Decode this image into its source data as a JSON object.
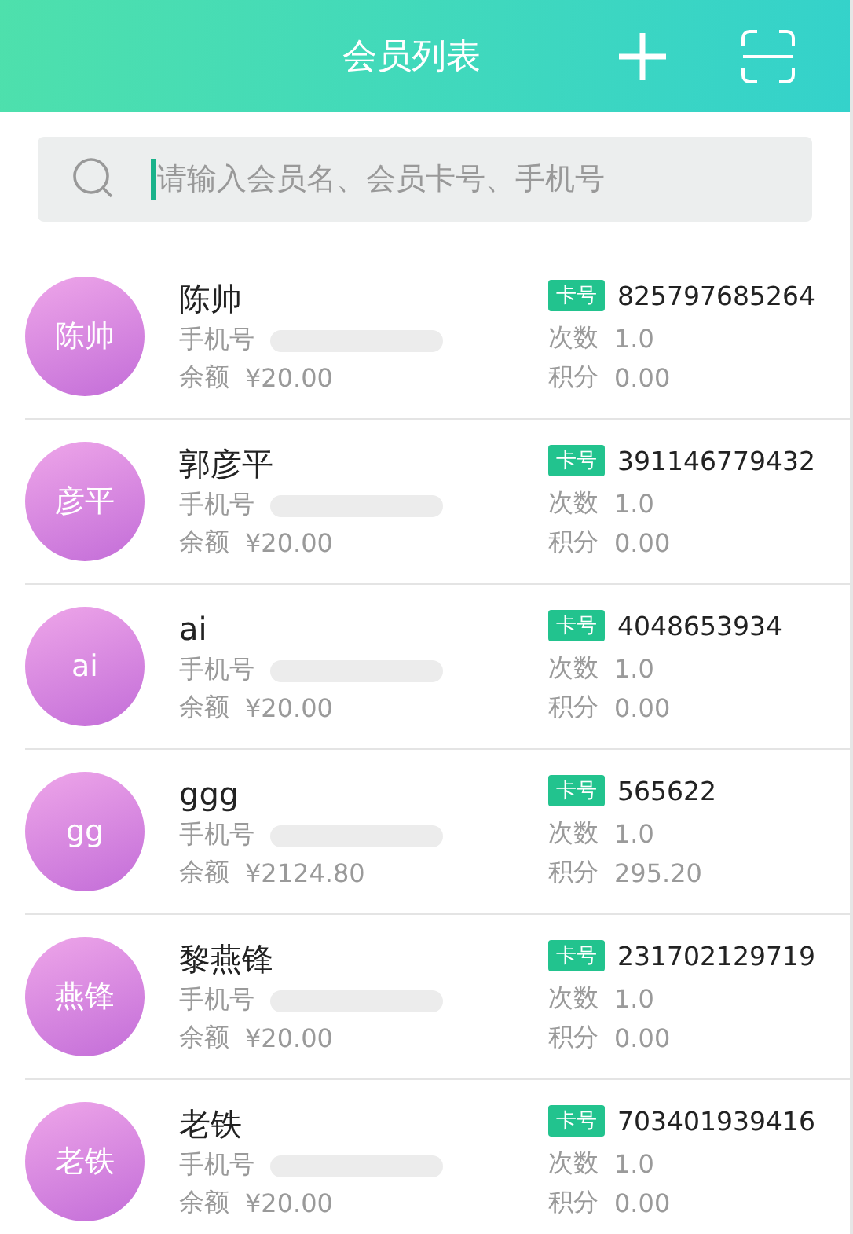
{
  "header": {
    "title": "会员列表"
  },
  "search": {
    "placeholder": "请输入会员名、会员卡号、手机号"
  },
  "members": [
    {
      "avatar": "陈帅",
      "name": "陈帅",
      "phone_label": "手机号",
      "balance_label": "余额",
      "balance": "¥20.00",
      "card_tag": "卡号",
      "card_no": "825797685264",
      "count_label": "次数",
      "count": "1.0",
      "points_label": "积分",
      "points": "0.00"
    },
    {
      "avatar": "彦平",
      "name": "郭彦平",
      "phone_label": "手机号",
      "balance_label": "余额",
      "balance": "¥20.00",
      "card_tag": "卡号",
      "card_no": "391146779432",
      "count_label": "次数",
      "count": "1.0",
      "points_label": "积分",
      "points": "0.00"
    },
    {
      "avatar": "ai",
      "name": "ai",
      "phone_label": "手机号",
      "balance_label": "余额",
      "balance": "¥20.00",
      "card_tag": "卡号",
      "card_no": "4048653934",
      "count_label": "次数",
      "count": "1.0",
      "points_label": "积分",
      "points": "0.00"
    },
    {
      "avatar": "gg",
      "name": "ggg",
      "phone_label": "手机号",
      "balance_label": "余额",
      "balance": "¥2124.80",
      "card_tag": "卡号",
      "card_no": "565622",
      "count_label": "次数",
      "count": "1.0",
      "points_label": "积分",
      "points": "295.20"
    },
    {
      "avatar": "燕锋",
      "name": "黎燕锋",
      "phone_label": "手机号",
      "balance_label": "余额",
      "balance": "¥20.00",
      "card_tag": "卡号",
      "card_no": "231702129719",
      "count_label": "次数",
      "count": "1.0",
      "points_label": "积分",
      "points": "0.00"
    },
    {
      "avatar": "老铁",
      "name": "老铁",
      "phone_label": "手机号",
      "balance_label": "余额",
      "balance": "¥20.00",
      "card_tag": "卡号",
      "card_no": "703401939416",
      "count_label": "次数",
      "count": "1.0",
      "points_label": "积分",
      "points": "0.00"
    }
  ]
}
